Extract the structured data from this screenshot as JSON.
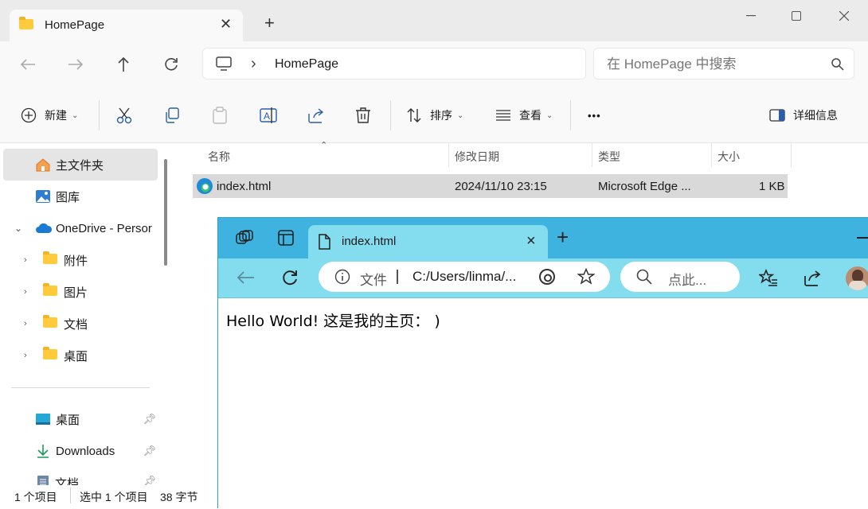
{
  "explorer": {
    "tab_title": "HomePage",
    "new_tab": "+",
    "address": {
      "path": "HomePage",
      "chevron": "›"
    },
    "search": {
      "placeholder": "在 HomePage 中搜索"
    },
    "toolbar": {
      "new_label": "新建",
      "sort_label": "排序",
      "view_label": "查看",
      "more_label": "•••",
      "details_label": "详细信息"
    },
    "sidebar": {
      "home": "主文件夹",
      "gallery": "图库",
      "onedrive": "OneDrive - Persor",
      "sub": [
        "附件",
        "图片",
        "文档",
        "桌面"
      ],
      "pinned": [
        "桌面",
        "Downloads",
        "文档"
      ]
    },
    "columns": {
      "name": "名称",
      "modified": "修改日期",
      "type": "类型",
      "size": "大小"
    },
    "files": [
      {
        "name": "index.html",
        "modified": "2024/11/10 23:15",
        "type": "Microsoft Edge ...",
        "size": "1 KB"
      }
    ],
    "status": {
      "count": "1 个项目",
      "selected": "选中 1 个项目",
      "bytes": "38 字节"
    }
  },
  "edge": {
    "tab_title": "index.html",
    "tab_close": "×",
    "new_tab": "+",
    "address": {
      "file_label": "文件",
      "url": "C:/Users/linma/..."
    },
    "search_placeholder": "点此...",
    "page_text": "Hello World! 这是我的主页： )"
  },
  "colors": {
    "edge_frame": "#3fb3e0",
    "edge_tab": "#84ddef",
    "selected_row": "#d9d9d9",
    "folder": "#ffcb3d"
  }
}
